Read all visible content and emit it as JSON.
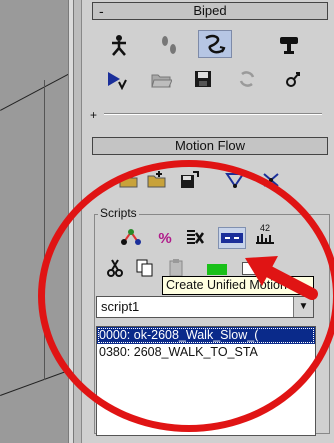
{
  "biped": {
    "title": "Biped",
    "collapse_symbol": "-",
    "row1_icons": [
      "figure-mode-icon",
      "footsteps-icon",
      "motion-flow-icon",
      "mixer-icon"
    ],
    "row2_icons": [
      "play-biped-icon",
      "open-file-icon",
      "save-file-icon",
      "load-icon",
      "move-icon"
    ],
    "expand_symbol": "+"
  },
  "motion_flow": {
    "title": "Motion Flow",
    "tools": [
      "load-mfe-icon",
      "append-icon",
      "save-mfe-icon",
      "create-transition-icon",
      "delete-icon"
    ]
  },
  "scripts": {
    "group_label": "Scripts",
    "row1_icons": [
      "create-random-motions-icon",
      "percent-icon",
      "delete-script-icon",
      "create-unified-motion-icon",
      "show-random-icon"
    ],
    "row2_icons": [
      "cut-icon",
      "copy-icon",
      "paste-icon",
      "green-bar-icon",
      "white-bar-icon"
    ],
    "unified_number": "42",
    "tooltip": "Create Unified Motion",
    "selected_script": "script1",
    "list": [
      {
        "text": "0000: ok-2608_Walk_Slow_(",
        "selected": true
      },
      {
        "text": "0380: 2608_WALK_TO_STA",
        "selected": false
      }
    ]
  },
  "colors": {
    "annotation": "#e01414",
    "selection": "#0a2a8a",
    "tooltip_bg": "#ffffe1"
  }
}
